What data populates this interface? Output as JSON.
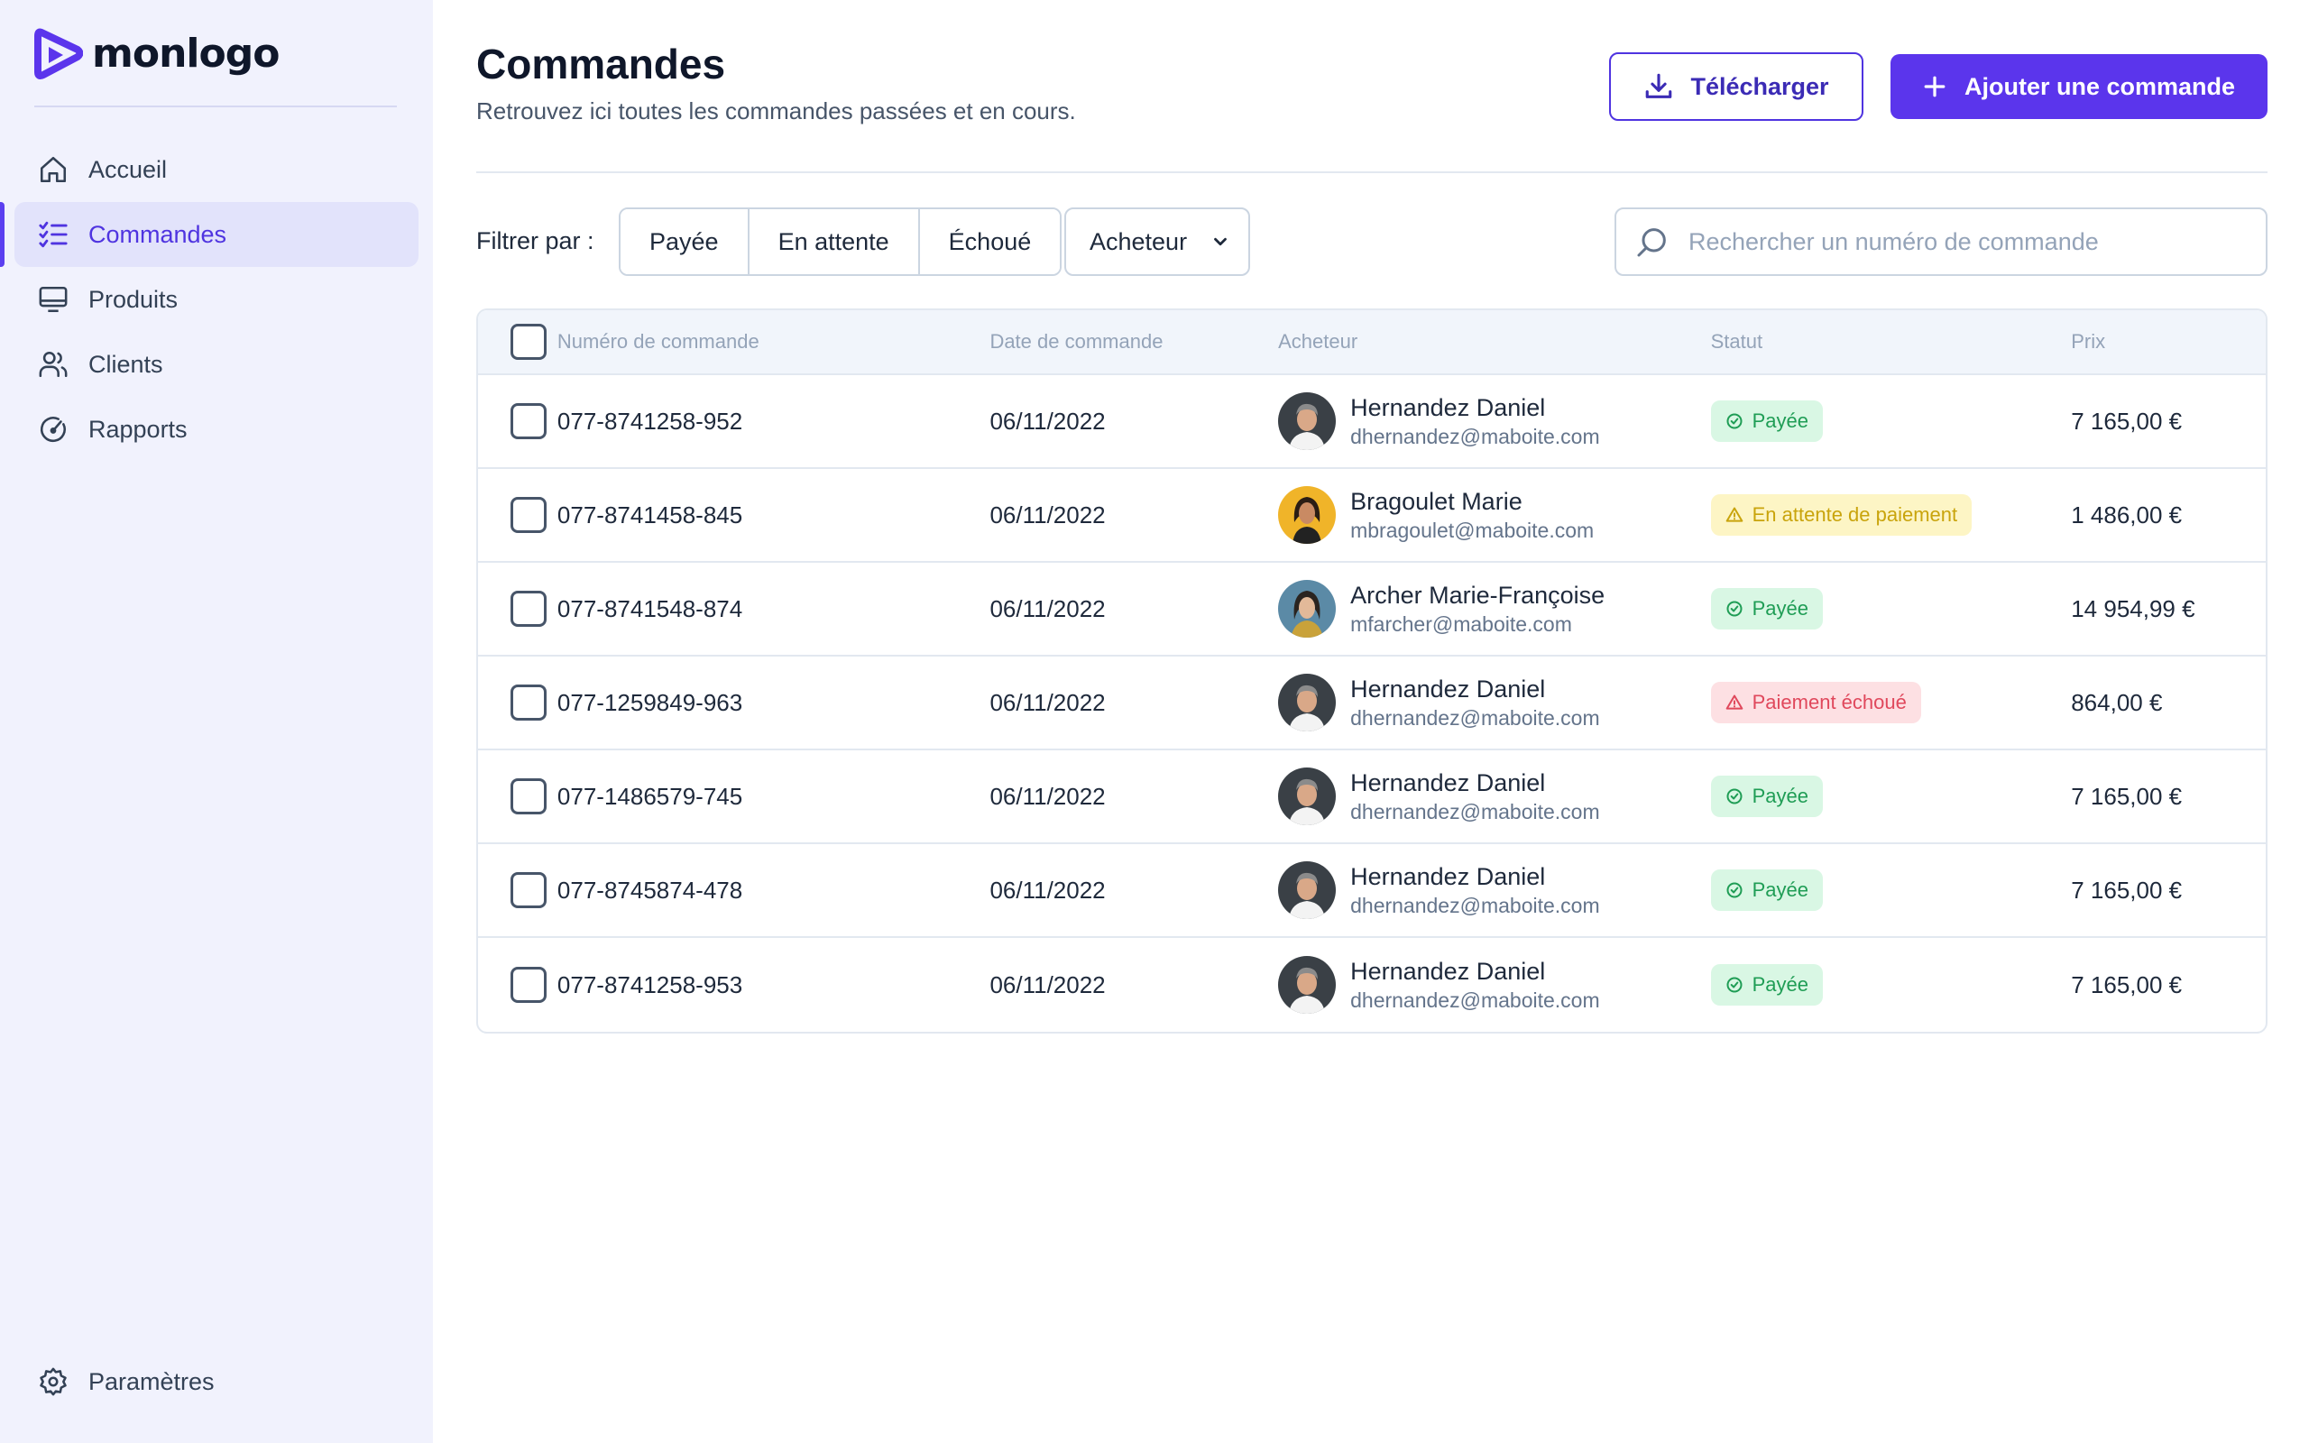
{
  "brand": {
    "name": "monlogo",
    "accent": "#5b35ec"
  },
  "sidebar": {
    "items": [
      {
        "label": "Accueil",
        "icon": "home-icon"
      },
      {
        "label": "Commandes",
        "icon": "list-check-icon",
        "active": true
      },
      {
        "label": "Produits",
        "icon": "monitor-icon"
      },
      {
        "label": "Clients",
        "icon": "users-icon"
      },
      {
        "label": "Rapports",
        "icon": "gauge-icon"
      }
    ],
    "settings": {
      "label": "Paramètres",
      "icon": "gear-icon"
    }
  },
  "header": {
    "title": "Commandes",
    "subtitle": "Retrouvez ici toutes les commandes passées et en cours.",
    "download_label": "Télécharger",
    "add_label": "Ajouter une commande"
  },
  "filters": {
    "label": "Filtrer par :",
    "segments": [
      "Payée",
      "En attente",
      "Échoué"
    ],
    "buyer_select": "Acheteur",
    "search_placeholder": "Rechercher un numéro de commande"
  },
  "table": {
    "columns": [
      "Numéro de commande",
      "Date de commande",
      "Acheteur",
      "Statut",
      "Prix"
    ],
    "rows": [
      {
        "number": "077-8741258-952",
        "date": "06/11/2022",
        "buyer": "Hernandez Daniel",
        "email": "dhernandez@maboite.com",
        "avatar": "man",
        "status": "Payée",
        "status_type": "paid",
        "price": "7 165,00 €"
      },
      {
        "number": "077-8741458-845",
        "date": "06/11/2022",
        "buyer": "Bragoulet Marie",
        "email": "mbragoulet@maboite.com",
        "avatar": "woman-yellow",
        "status": "En attente de paiement",
        "status_type": "pending",
        "price": "1 486,00 €"
      },
      {
        "number": "077-8741548-874",
        "date": "06/11/2022",
        "buyer": "Archer Marie-Françoise",
        "email": "mfarcher@maboite.com",
        "avatar": "woman-blue",
        "status": "Payée",
        "status_type": "paid",
        "price": "14 954,99 €"
      },
      {
        "number": "077-1259849-963",
        "date": "06/11/2022",
        "buyer": "Hernandez Daniel",
        "email": "dhernandez@maboite.com",
        "avatar": "man",
        "status": "Paiement échoué",
        "status_type": "failed",
        "price": "864,00 €"
      },
      {
        "number": "077-1486579-745",
        "date": "06/11/2022",
        "buyer": "Hernandez Daniel",
        "email": "dhernandez@maboite.com",
        "avatar": "man",
        "status": "Payée",
        "status_type": "paid",
        "price": "7 165,00 €"
      },
      {
        "number": "077-8745874-478",
        "date": "06/11/2022",
        "buyer": "Hernandez Daniel",
        "email": "dhernandez@maboite.com",
        "avatar": "man",
        "status": "Payée",
        "status_type": "paid",
        "price": "7 165,00 €"
      },
      {
        "number": "077-8741258-953",
        "date": "06/11/2022",
        "buyer": "Hernandez Daniel",
        "email": "dhernandez@maboite.com",
        "avatar": "man",
        "status": "Payée",
        "status_type": "paid",
        "price": "7 165,00 €"
      }
    ]
  },
  "status_colors": {
    "paid": "#1f9d55",
    "pending": "#c9a40c",
    "failed": "#e0485c"
  }
}
